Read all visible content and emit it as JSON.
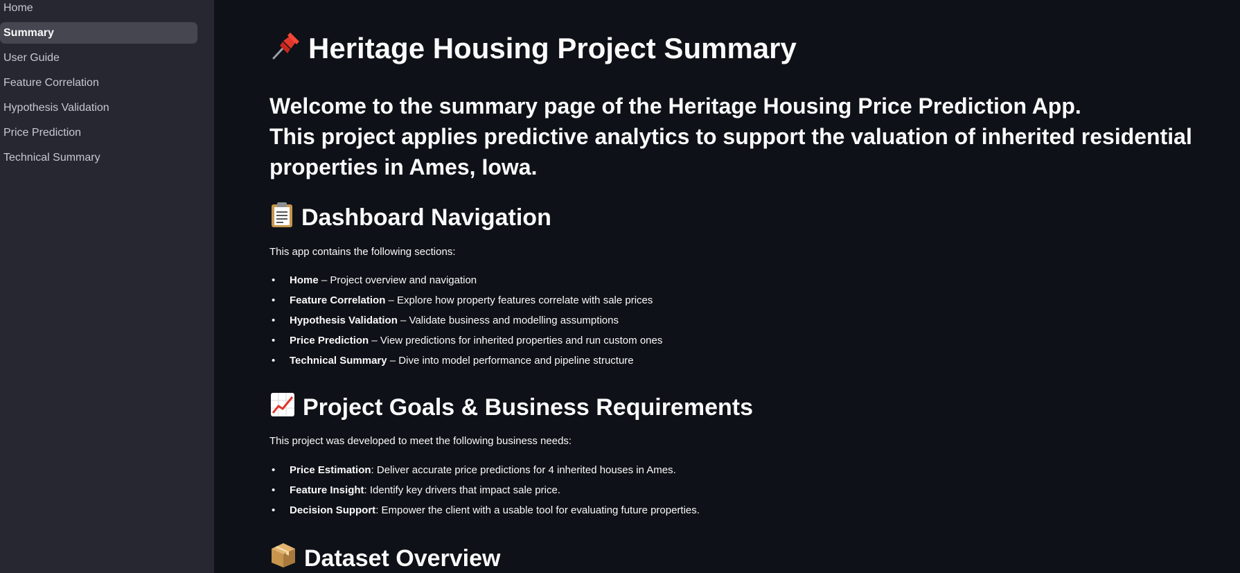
{
  "sidebar": {
    "items": [
      {
        "label": "Home",
        "active": false
      },
      {
        "label": "Summary",
        "active": true
      },
      {
        "label": "User Guide",
        "active": false
      },
      {
        "label": "Feature Correlation",
        "active": false
      },
      {
        "label": "Hypothesis Validation",
        "active": false
      },
      {
        "label": "Price Prediction",
        "active": false
      },
      {
        "label": "Technical Summary",
        "active": false
      }
    ]
  },
  "main": {
    "title": "Heritage Housing Project Summary",
    "title_icon": "pushpin-icon",
    "welcome_lines": [
      "Welcome to the summary page of the Heritage Housing Price Prediction App.",
      "This project applies predictive analytics to support the valuation of inherited residential",
      "properties in Ames, Iowa."
    ],
    "navigation": {
      "heading": "Dashboard Navigation",
      "icon": "clipboard-icon",
      "intro": "This app contains the following sections:",
      "items": [
        {
          "name": "Home",
          "desc": " – Project overview and navigation"
        },
        {
          "name": "Feature Correlation",
          "desc": " – Explore how property features correlate with sale prices"
        },
        {
          "name": "Hypothesis Validation",
          "desc": " – Validate business and modelling assumptions"
        },
        {
          "name": "Price Prediction",
          "desc": " – View predictions for inherited properties and run custom ones"
        },
        {
          "name": "Technical Summary",
          "desc": " – Dive into model performance and pipeline structure"
        }
      ]
    },
    "goals": {
      "heading": "Project Goals & Business Requirements",
      "icon": "chart-increasing-icon",
      "intro": "This project was developed to meet the following business needs:",
      "items": [
        {
          "name": "Price Estimation",
          "desc": ": Deliver accurate price predictions for 4 inherited houses in Ames."
        },
        {
          "name": "Feature Insight",
          "desc": ": Identify key drivers that impact sale price."
        },
        {
          "name": "Decision Support",
          "desc": ": Empower the client with a usable tool for evaluating future properties."
        }
      ]
    },
    "dataset": {
      "heading": "Dataset Overview",
      "icon": "package-icon"
    }
  }
}
